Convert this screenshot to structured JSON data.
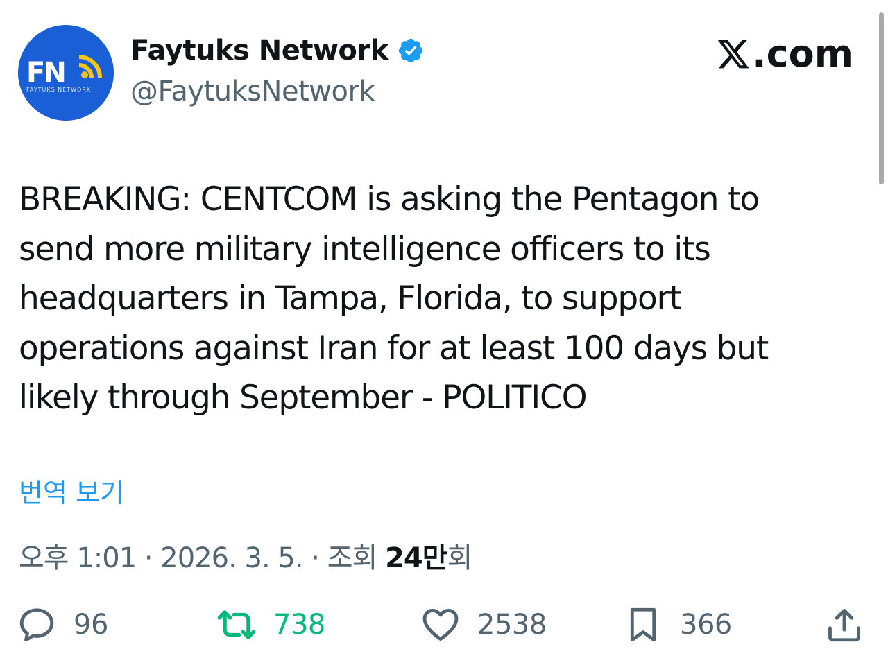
{
  "author": {
    "display_name": "Faytuks Network",
    "handle": "@FaytuksNetwork",
    "avatar_text": "FN",
    "avatar_subtext": "FAYTUKS NETWORK",
    "verified": true
  },
  "site_logo": {
    "suffix": ".com",
    "icon": "x-logo-icon"
  },
  "tweet": {
    "lines": [
      "BREAKING: CENTCOM is asking the Pentagon to",
      "send more military intelligence officers to its",
      "headquarters in Tampa, Florida, to support",
      "operations against Iran for at least 100 days but",
      "likely through September - POLITICO"
    ],
    "translate_label": "번역 보기"
  },
  "meta": {
    "time": "오후 1:01",
    "separator": " · ",
    "date": "2026. 3. 5.",
    "views_label": "조회 ",
    "views_count": "24만",
    "views_suffix": "회"
  },
  "actions": {
    "reply": {
      "count": "96",
      "icon": "reply-icon"
    },
    "retweet": {
      "count": "738",
      "icon": "retweet-icon"
    },
    "like": {
      "count": "2538",
      "icon": "heart-icon"
    },
    "bookmark": {
      "count": "366",
      "icon": "bookmark-icon"
    },
    "share": {
      "icon": "share-icon"
    }
  },
  "colors": {
    "link_blue": "#1d9bf0",
    "retweet_green": "#00ba7c",
    "secondary_text": "#536471",
    "primary_text": "#0f1419",
    "avatar_blue": "#1a5fd6",
    "avatar_yellow": "#f5c518"
  }
}
